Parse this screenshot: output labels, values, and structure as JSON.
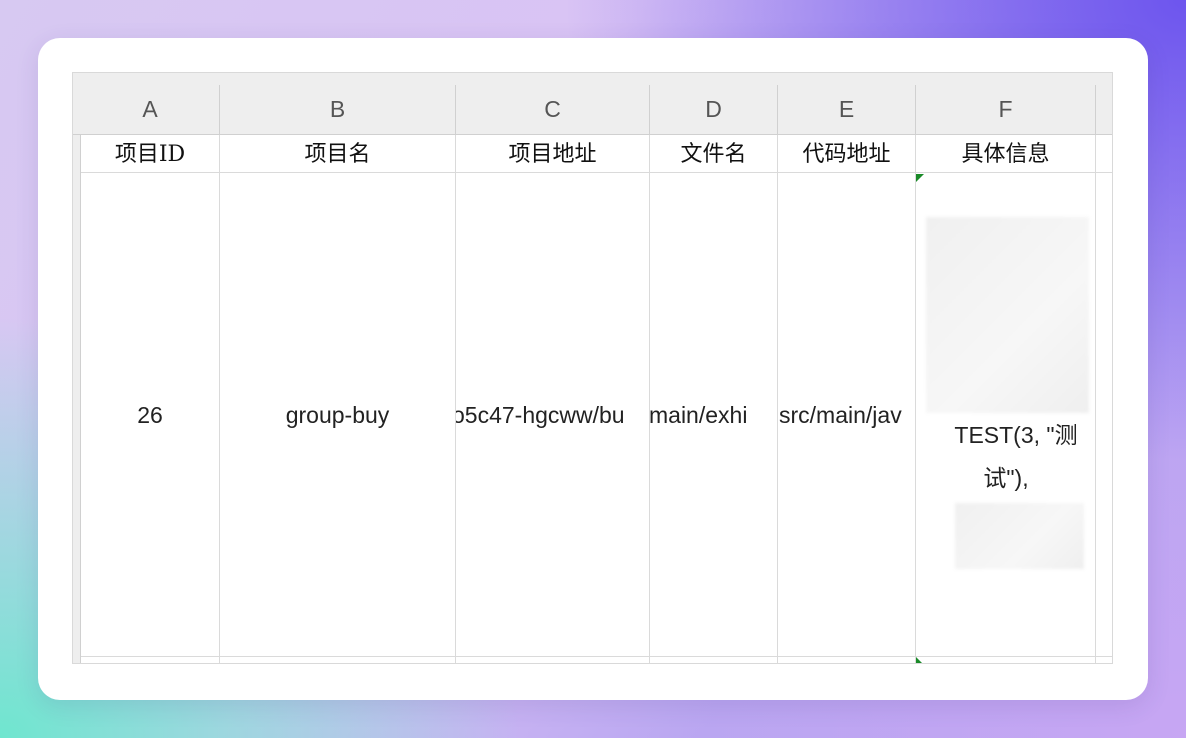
{
  "columns": [
    "A",
    "B",
    "C",
    "D",
    "E",
    "F"
  ],
  "header_row": {
    "a": "项目ID",
    "b": "项目名",
    "c": "项目地址",
    "d": "文件名",
    "e": "代码地址",
    "f": "具体信息"
  },
  "data_row": {
    "a": "26",
    "b": "group-buy",
    "c": "o5c47-hgcww/bu",
    "d": "main/exhi",
    "e": "src/main/jav",
    "f_line1": "TEST(3, \"测",
    "f_line2": "试\"),"
  }
}
